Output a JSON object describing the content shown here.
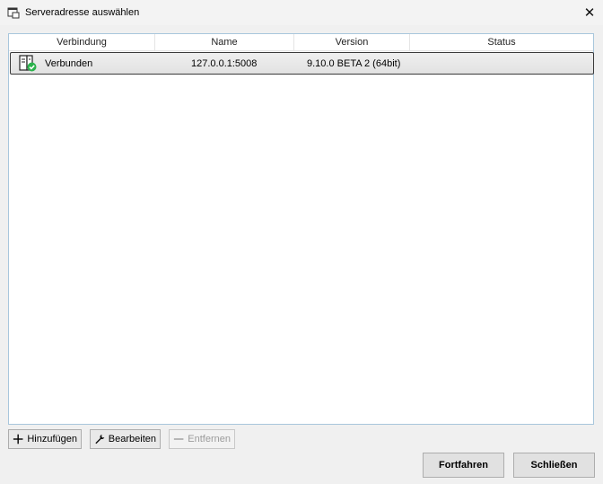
{
  "window": {
    "title": "Serveradresse auswählen",
    "close_glyph": "✕"
  },
  "table": {
    "columns": [
      "Verbindung",
      "Name",
      "Version",
      "Status"
    ],
    "rows": [
      {
        "icon": "server-connected-icon",
        "connection": "Verbunden",
        "name": "127.0.0.1:5008",
        "version": "9.10.0 BETA 2 (64bit)",
        "status": ""
      }
    ]
  },
  "toolbar": {
    "add_label": "Hinzufügen",
    "edit_label": "Bearbeiten",
    "remove_label": "Entfernen"
  },
  "actions": {
    "continue_label": "Fortfahren",
    "close_label": "Schließen"
  },
  "colors": {
    "status_ok": "#2bb24c",
    "list_border": "#a8c6dc"
  }
}
